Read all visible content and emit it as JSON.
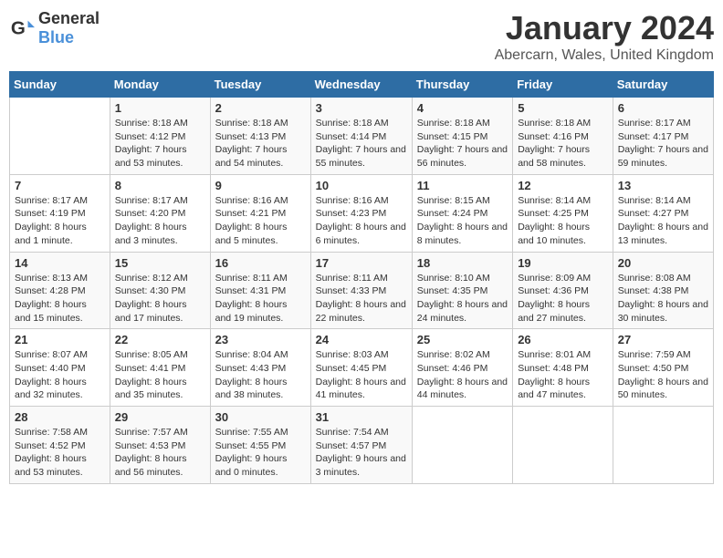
{
  "logo": {
    "text_general": "General",
    "text_blue": "Blue"
  },
  "header": {
    "month": "January 2024",
    "location": "Abercarn, Wales, United Kingdom"
  },
  "weekdays": [
    "Sunday",
    "Monday",
    "Tuesday",
    "Wednesday",
    "Thursday",
    "Friday",
    "Saturday"
  ],
  "weeks": [
    [
      {
        "day": "",
        "sunrise": "",
        "sunset": "",
        "daylight": ""
      },
      {
        "day": "1",
        "sunrise": "Sunrise: 8:18 AM",
        "sunset": "Sunset: 4:12 PM",
        "daylight": "Daylight: 7 hours and 53 minutes."
      },
      {
        "day": "2",
        "sunrise": "Sunrise: 8:18 AM",
        "sunset": "Sunset: 4:13 PM",
        "daylight": "Daylight: 7 hours and 54 minutes."
      },
      {
        "day": "3",
        "sunrise": "Sunrise: 8:18 AM",
        "sunset": "Sunset: 4:14 PM",
        "daylight": "Daylight: 7 hours and 55 minutes."
      },
      {
        "day": "4",
        "sunrise": "Sunrise: 8:18 AM",
        "sunset": "Sunset: 4:15 PM",
        "daylight": "Daylight: 7 hours and 56 minutes."
      },
      {
        "day": "5",
        "sunrise": "Sunrise: 8:18 AM",
        "sunset": "Sunset: 4:16 PM",
        "daylight": "Daylight: 7 hours and 58 minutes."
      },
      {
        "day": "6",
        "sunrise": "Sunrise: 8:17 AM",
        "sunset": "Sunset: 4:17 PM",
        "daylight": "Daylight: 7 hours and 59 minutes."
      }
    ],
    [
      {
        "day": "7",
        "sunrise": "Sunrise: 8:17 AM",
        "sunset": "Sunset: 4:19 PM",
        "daylight": "Daylight: 8 hours and 1 minute."
      },
      {
        "day": "8",
        "sunrise": "Sunrise: 8:17 AM",
        "sunset": "Sunset: 4:20 PM",
        "daylight": "Daylight: 8 hours and 3 minutes."
      },
      {
        "day": "9",
        "sunrise": "Sunrise: 8:16 AM",
        "sunset": "Sunset: 4:21 PM",
        "daylight": "Daylight: 8 hours and 5 minutes."
      },
      {
        "day": "10",
        "sunrise": "Sunrise: 8:16 AM",
        "sunset": "Sunset: 4:23 PM",
        "daylight": "Daylight: 8 hours and 6 minutes."
      },
      {
        "day": "11",
        "sunrise": "Sunrise: 8:15 AM",
        "sunset": "Sunset: 4:24 PM",
        "daylight": "Daylight: 8 hours and 8 minutes."
      },
      {
        "day": "12",
        "sunrise": "Sunrise: 8:14 AM",
        "sunset": "Sunset: 4:25 PM",
        "daylight": "Daylight: 8 hours and 10 minutes."
      },
      {
        "day": "13",
        "sunrise": "Sunrise: 8:14 AM",
        "sunset": "Sunset: 4:27 PM",
        "daylight": "Daylight: 8 hours and 13 minutes."
      }
    ],
    [
      {
        "day": "14",
        "sunrise": "Sunrise: 8:13 AM",
        "sunset": "Sunset: 4:28 PM",
        "daylight": "Daylight: 8 hours and 15 minutes."
      },
      {
        "day": "15",
        "sunrise": "Sunrise: 8:12 AM",
        "sunset": "Sunset: 4:30 PM",
        "daylight": "Daylight: 8 hours and 17 minutes."
      },
      {
        "day": "16",
        "sunrise": "Sunrise: 8:11 AM",
        "sunset": "Sunset: 4:31 PM",
        "daylight": "Daylight: 8 hours and 19 minutes."
      },
      {
        "day": "17",
        "sunrise": "Sunrise: 8:11 AM",
        "sunset": "Sunset: 4:33 PM",
        "daylight": "Daylight: 8 hours and 22 minutes."
      },
      {
        "day": "18",
        "sunrise": "Sunrise: 8:10 AM",
        "sunset": "Sunset: 4:35 PM",
        "daylight": "Daylight: 8 hours and 24 minutes."
      },
      {
        "day": "19",
        "sunrise": "Sunrise: 8:09 AM",
        "sunset": "Sunset: 4:36 PM",
        "daylight": "Daylight: 8 hours and 27 minutes."
      },
      {
        "day": "20",
        "sunrise": "Sunrise: 8:08 AM",
        "sunset": "Sunset: 4:38 PM",
        "daylight": "Daylight: 8 hours and 30 minutes."
      }
    ],
    [
      {
        "day": "21",
        "sunrise": "Sunrise: 8:07 AM",
        "sunset": "Sunset: 4:40 PM",
        "daylight": "Daylight: 8 hours and 32 minutes."
      },
      {
        "day": "22",
        "sunrise": "Sunrise: 8:05 AM",
        "sunset": "Sunset: 4:41 PM",
        "daylight": "Daylight: 8 hours and 35 minutes."
      },
      {
        "day": "23",
        "sunrise": "Sunrise: 8:04 AM",
        "sunset": "Sunset: 4:43 PM",
        "daylight": "Daylight: 8 hours and 38 minutes."
      },
      {
        "day": "24",
        "sunrise": "Sunrise: 8:03 AM",
        "sunset": "Sunset: 4:45 PM",
        "daylight": "Daylight: 8 hours and 41 minutes."
      },
      {
        "day": "25",
        "sunrise": "Sunrise: 8:02 AM",
        "sunset": "Sunset: 4:46 PM",
        "daylight": "Daylight: 8 hours and 44 minutes."
      },
      {
        "day": "26",
        "sunrise": "Sunrise: 8:01 AM",
        "sunset": "Sunset: 4:48 PM",
        "daylight": "Daylight: 8 hours and 47 minutes."
      },
      {
        "day": "27",
        "sunrise": "Sunrise: 7:59 AM",
        "sunset": "Sunset: 4:50 PM",
        "daylight": "Daylight: 8 hours and 50 minutes."
      }
    ],
    [
      {
        "day": "28",
        "sunrise": "Sunrise: 7:58 AM",
        "sunset": "Sunset: 4:52 PM",
        "daylight": "Daylight: 8 hours and 53 minutes."
      },
      {
        "day": "29",
        "sunrise": "Sunrise: 7:57 AM",
        "sunset": "Sunset: 4:53 PM",
        "daylight": "Daylight: 8 hours and 56 minutes."
      },
      {
        "day": "30",
        "sunrise": "Sunrise: 7:55 AM",
        "sunset": "Sunset: 4:55 PM",
        "daylight": "Daylight: 9 hours and 0 minutes."
      },
      {
        "day": "31",
        "sunrise": "Sunrise: 7:54 AM",
        "sunset": "Sunset: 4:57 PM",
        "daylight": "Daylight: 9 hours and 3 minutes."
      },
      {
        "day": "",
        "sunrise": "",
        "sunset": "",
        "daylight": ""
      },
      {
        "day": "",
        "sunrise": "",
        "sunset": "",
        "daylight": ""
      },
      {
        "day": "",
        "sunrise": "",
        "sunset": "",
        "daylight": ""
      }
    ]
  ]
}
